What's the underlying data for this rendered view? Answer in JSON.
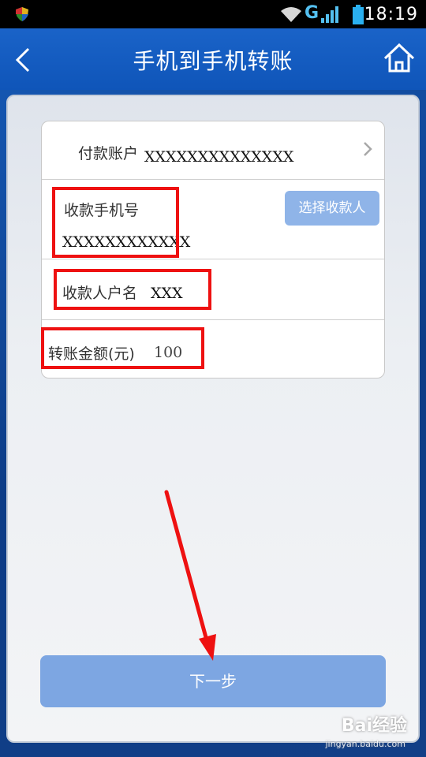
{
  "status_bar": {
    "time": "18:19",
    "network": "G",
    "icons": [
      "shield-icon",
      "wifi-icon",
      "signal-icon",
      "battery-icon"
    ]
  },
  "header": {
    "title": "手机到手机转账",
    "back_icon": "chevron-left-icon",
    "home_icon": "home-icon"
  },
  "form": {
    "payer_account": {
      "label": "付款账户",
      "value": "XXXXXXXXXXXXXX"
    },
    "payee_phone": {
      "label": "收款手机号",
      "value": "XXXXXXXXXXXX"
    },
    "select_payee_button": "选择收款人",
    "payee_name": {
      "label": "收款人户名",
      "value": "XXX"
    },
    "amount": {
      "label": "转账金额(元)",
      "value": "100"
    }
  },
  "next_button": "下一步",
  "watermark": {
    "brand": "Bai经验",
    "url": "jingyan.baidu.com"
  },
  "colors": {
    "header_blue": "#1a63c8",
    "button_blue": "#7da6e2",
    "annotation_red": "#ee1111"
  }
}
